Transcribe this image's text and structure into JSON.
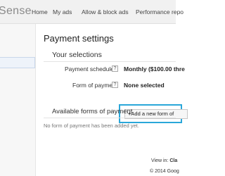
{
  "header": {
    "logo_text": "Sense",
    "nav": [
      "Home",
      "My ads",
      "Allow & block ads",
      "Performance repo"
    ]
  },
  "main": {
    "title": "Payment settings",
    "selections": {
      "heading": "Your selections",
      "payment_schedule": {
        "label": "Payment schedule",
        "value": "Monthly ($100.00 thre"
      },
      "form_of_payment": {
        "label": "Form of payment",
        "value": "None selected"
      }
    },
    "add_button_label": "Add a new form of",
    "available": {
      "heading": "Available forms of payment",
      "empty_message": "No form of payment has been added yet."
    }
  },
  "footer": {
    "view_in_prefix": "View in:",
    "view_in_value": "Cla",
    "copyright": "© 2014 Goog"
  },
  "icons": {
    "help": "question-mark",
    "add": "plus"
  }
}
